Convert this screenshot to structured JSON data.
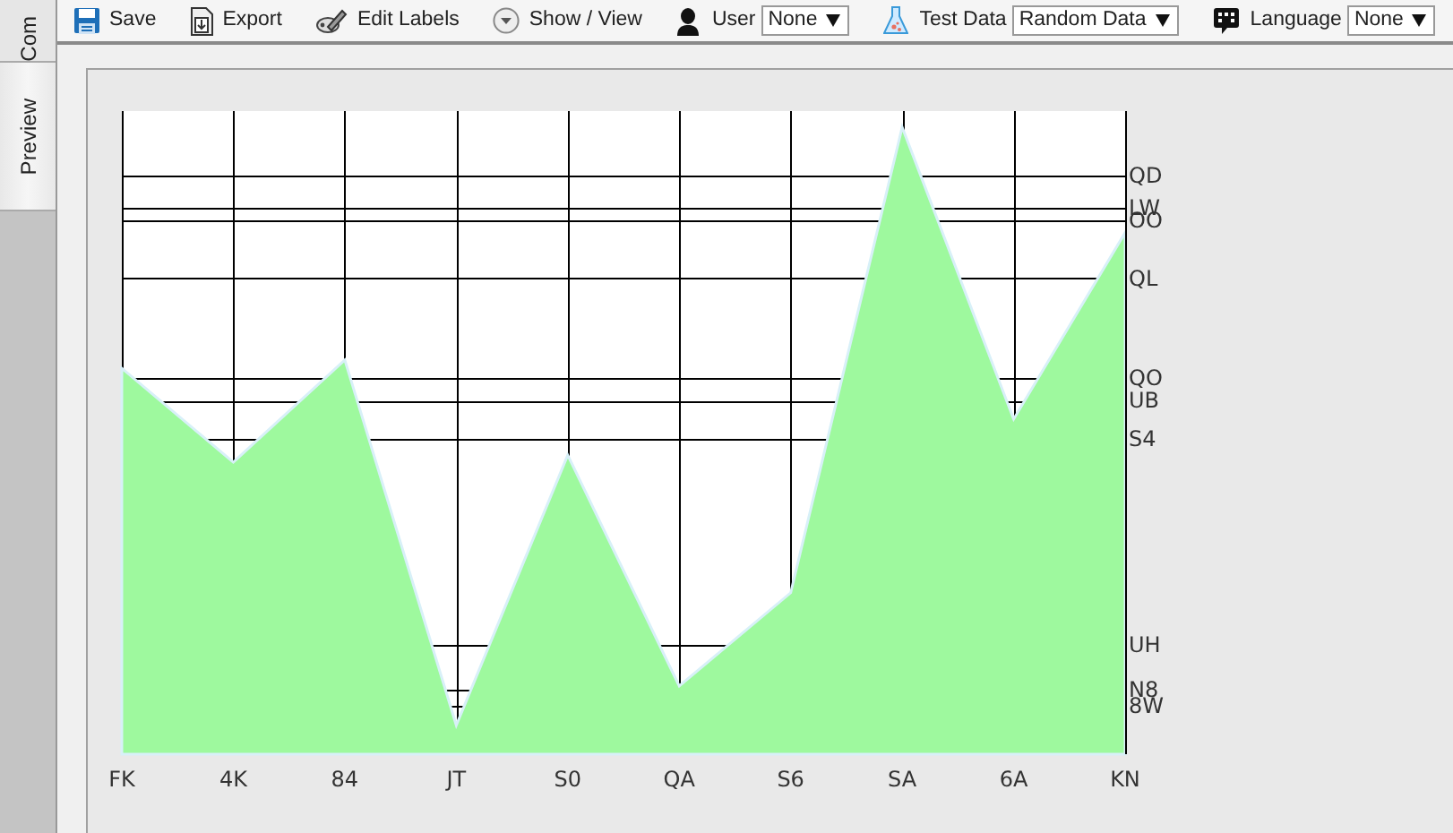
{
  "side_tabs": [
    {
      "label": "Com",
      "selected": false
    },
    {
      "label": "Preview",
      "selected": true
    }
  ],
  "toolbar": [
    {
      "kind": "button",
      "label": "Save"
    },
    {
      "kind": "button",
      "label": "Export"
    },
    {
      "kind": "button",
      "label": "Edit Labels"
    },
    {
      "kind": "button",
      "label": "Show / View"
    },
    {
      "kind": "select",
      "label": "User",
      "value": "None"
    },
    {
      "kind": "select",
      "label": "Test Data",
      "value": "Random Data"
    },
    {
      "kind": "select",
      "label": "Language",
      "value": "None"
    }
  ],
  "chart": {
    "x_labels": [
      "FK",
      "4K",
      "84",
      "JT",
      "S0",
      "QA",
      "S6",
      "SA",
      "6A",
      "KN"
    ],
    "y_labels": [
      "QD",
      "LW",
      "OO",
      "QL",
      "QO",
      "UB",
      "S4",
      "UH",
      "N8",
      "8W"
    ]
  }
}
